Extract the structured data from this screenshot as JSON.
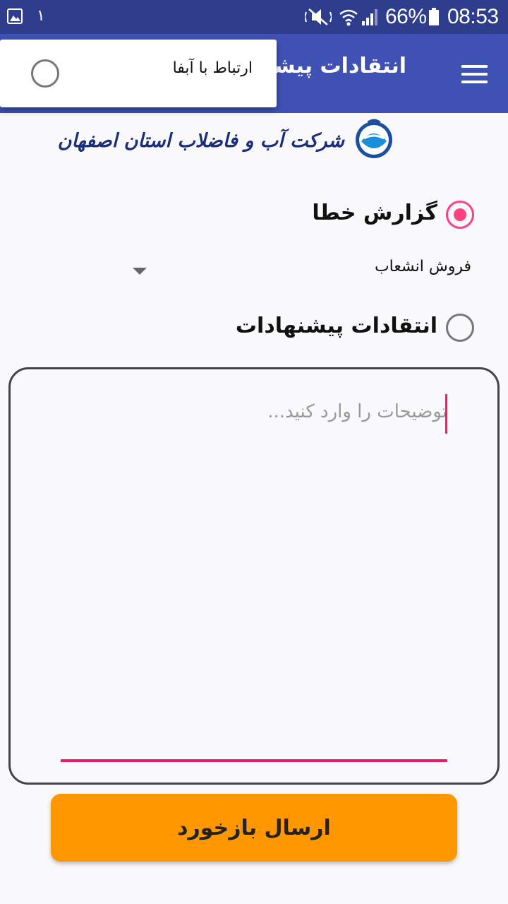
{
  "status_bar": {
    "notification_text": "١",
    "battery_percent": "66%",
    "time": "08:53",
    "icons": [
      "gallery-icon",
      "mute-icon",
      "wifi-icon",
      "signal-icon",
      "battery-icon"
    ]
  },
  "app_bar": {
    "title": "انتقادات پیشنهادات",
    "menu_icon": "hamburger-menu-icon",
    "background": "#3f51b5"
  },
  "popup": {
    "label": "ارتباط با آبفا"
  },
  "logo": {
    "text": "شرکت آب و فاضلاب استان اصفهان",
    "emblem_icon": "water-drop-logo-icon"
  },
  "form": {
    "option_error_report": {
      "label": "گزارش خطا",
      "selected": true
    },
    "spinner": {
      "selected": "فروش انشعاب"
    },
    "option_suggestions": {
      "label": "انتقادات پیشنهادات",
      "selected": false
    },
    "description": {
      "placeholder": "توضیحات را وارد کنید...",
      "value": ""
    },
    "submit_label": "ارسال بازخورد"
  },
  "colors": {
    "status_bar": "#2e3e8c",
    "accent": "#ff4081",
    "button": "#ff9800"
  }
}
